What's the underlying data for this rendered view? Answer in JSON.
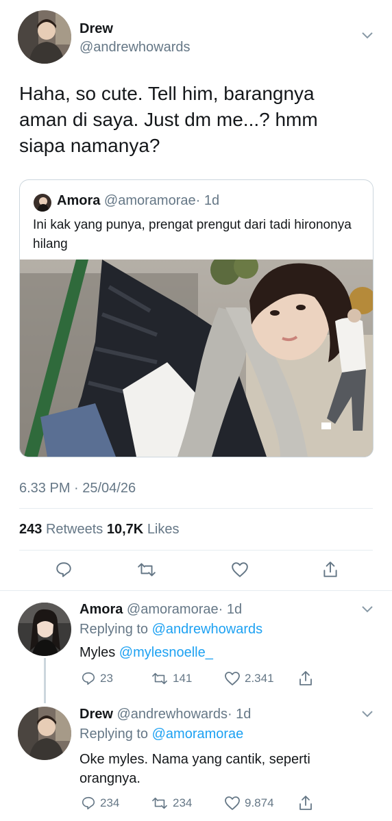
{
  "main_tweet": {
    "author_name": "Drew",
    "author_handle": "@andrewhowards",
    "text": "Haha, so cute. Tell him, barangnya aman di saya. Just dm me...? hmm siapa namanya?",
    "timestamp": "6.33 PM · 25/04/26",
    "retweets_count": "243",
    "retweets_label": "Retweets",
    "likes_count": "10,7K",
    "likes_label": "Likes"
  },
  "quoted_tweet": {
    "author_name": "Amora",
    "author_handle": "@amoramorae",
    "time": "· 1d",
    "text": "Ini kak yang punya, prengat prengut dari tadi hirononya hilang"
  },
  "replies": [
    {
      "author_name": "Amora",
      "author_handle": "@amoramorae",
      "time": "· 1d",
      "replying_prefix": "Replying to",
      "replying_to": "@andrewhowards",
      "text_prefix": "Myles",
      "text_mention": "@mylesnoelle_",
      "replies": "23",
      "retweets": "141",
      "likes": "2.341"
    },
    {
      "author_name": "Drew",
      "author_handle": "@andrewhowards",
      "time": "· 1d",
      "replying_prefix": "Replying to",
      "replying_to": "@amoramorae",
      "text": "Oke myles. Nama yang cantik, seperti orangnya.",
      "replies": "234",
      "retweets": "234",
      "likes": "9.874"
    }
  ],
  "colors": {
    "accent": "#1da1f2",
    "secondary_text": "#657786",
    "divider": "#e6ecf0"
  }
}
